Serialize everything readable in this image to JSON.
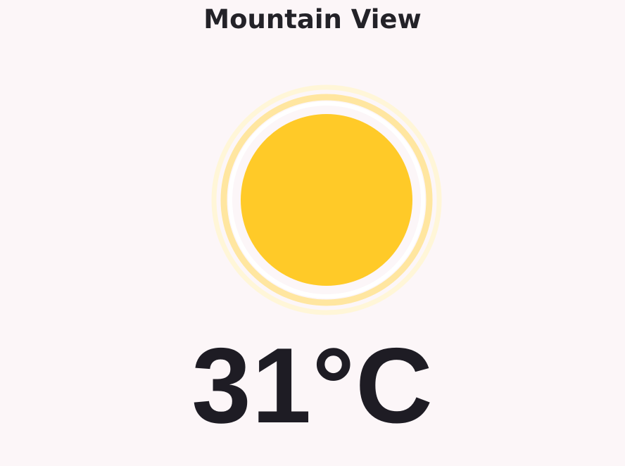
{
  "location": {
    "name": "Mountain View"
  },
  "weather": {
    "icon": "sun-icon",
    "temperature_text": "31°C",
    "colors": {
      "sun": "#ffca28",
      "glow": "#ffe082",
      "background": "#fcf6f8",
      "text": "#1e1c24"
    }
  }
}
